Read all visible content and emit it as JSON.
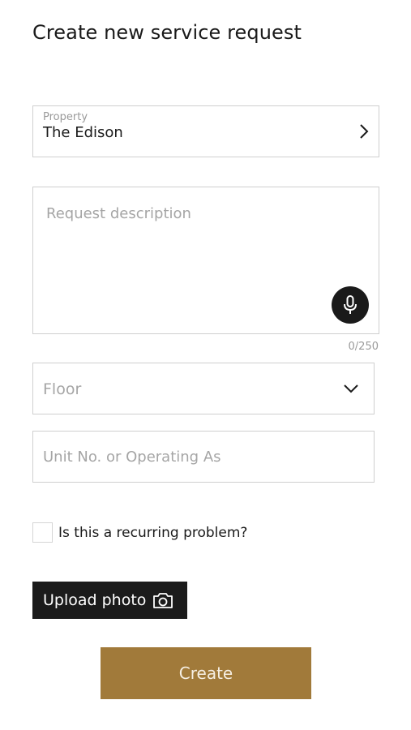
{
  "page": {
    "title": "Create new service request"
  },
  "form": {
    "property": {
      "label": "Property",
      "value": "The Edison",
      "icon": "chevron-right-icon"
    },
    "description": {
      "placeholder": "Request description",
      "counter": "0/250",
      "mic_icon": "microphone-icon"
    },
    "floor": {
      "placeholder": "Floor",
      "icon": "chevron-down-icon"
    },
    "unit": {
      "placeholder": "Unit No. or Operating As"
    },
    "recurring": {
      "label": "Is this a recurring problem?",
      "checked": false
    },
    "upload": {
      "label": "Upload photo",
      "icon": "camera-icon"
    },
    "create": {
      "label": "Create"
    }
  },
  "colors": {
    "accent": "#a17a3a",
    "dark": "#1b1b1b",
    "border": "#cfcfcf",
    "placeholder": "#a5a5a5"
  }
}
